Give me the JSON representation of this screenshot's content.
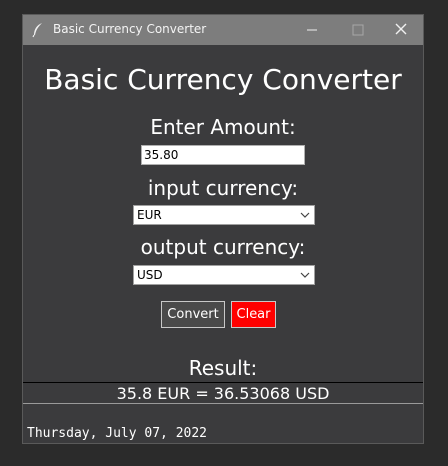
{
  "window": {
    "title": "Basic Currency Converter"
  },
  "app": {
    "heading": "Basic Currency Converter",
    "amount_label": "Enter Amount:",
    "amount_value": "35.80",
    "input_currency_label": "input currency:",
    "input_currency_value": "EUR",
    "output_currency_label": "output currency:",
    "output_currency_value": "USD",
    "convert_label": "Convert",
    "clear_label": "Clear",
    "result_label": "Result:",
    "result_text": "35.8 EUR = 36.53068 USD",
    "date_text": "Thursday, July 07, 2022"
  },
  "colors": {
    "window_bg": "#3b3b3d",
    "titlebar_bg": "#7d7d7d",
    "clear_button": "#ff0000"
  },
  "icons": {
    "app_icon": "feather-icon",
    "minimize": "minimize-icon",
    "maximize": "maximize-icon",
    "close": "close-icon",
    "dropdown": "chevron-down-icon"
  }
}
